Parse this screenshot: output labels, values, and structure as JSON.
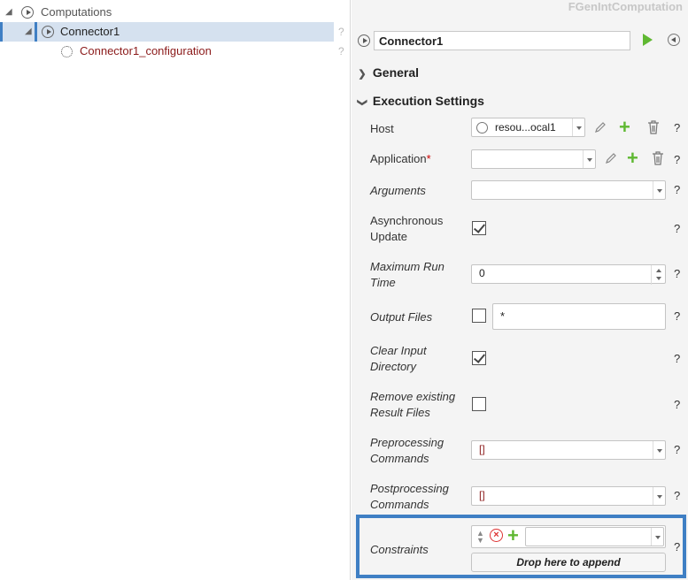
{
  "tree": {
    "root_label": "Computations",
    "selected_label": "Connector1",
    "child_label": "Connector1_configuration",
    "help": "?"
  },
  "panel": {
    "watermark": "FGenIntComputation",
    "name_value": "Connector1",
    "help": "?"
  },
  "sections": {
    "general": "General",
    "execution": "Execution Settings"
  },
  "fields": {
    "host": {
      "label": "Host",
      "value": "resou...ocal1"
    },
    "application": {
      "label": "Application",
      "required_mark": "*",
      "value": ""
    },
    "arguments": {
      "label": "Arguments",
      "value": ""
    },
    "async": {
      "label_line1": "Asynchronous",
      "label_line2": "Update",
      "checked": true
    },
    "max_run": {
      "label_line1": "Maximum Run",
      "label_line2": "Time",
      "value": "0"
    },
    "output_files": {
      "label": "Output Files",
      "checked": false,
      "value": "*"
    },
    "clear_input": {
      "label_line1": "Clear Input",
      "label_line2": "Directory",
      "checked": true
    },
    "remove_existing": {
      "label_line1": "Remove existing",
      "label_line2": "Result Files",
      "checked": false
    },
    "preprocessing": {
      "label_line1": "Preprocessing",
      "label_line2": "Commands",
      "value": "[]"
    },
    "postprocessing": {
      "label_line1": "Postprocessing",
      "label_line2": "Commands",
      "value": "[]"
    },
    "constraints": {
      "label": "Constraints",
      "value": "",
      "drop_text": "Drop here to append"
    }
  },
  "colors": {
    "accent_highlight": "#3f7fc4",
    "add_green": "#5fb832",
    "value_red": "#8b1a1a"
  }
}
